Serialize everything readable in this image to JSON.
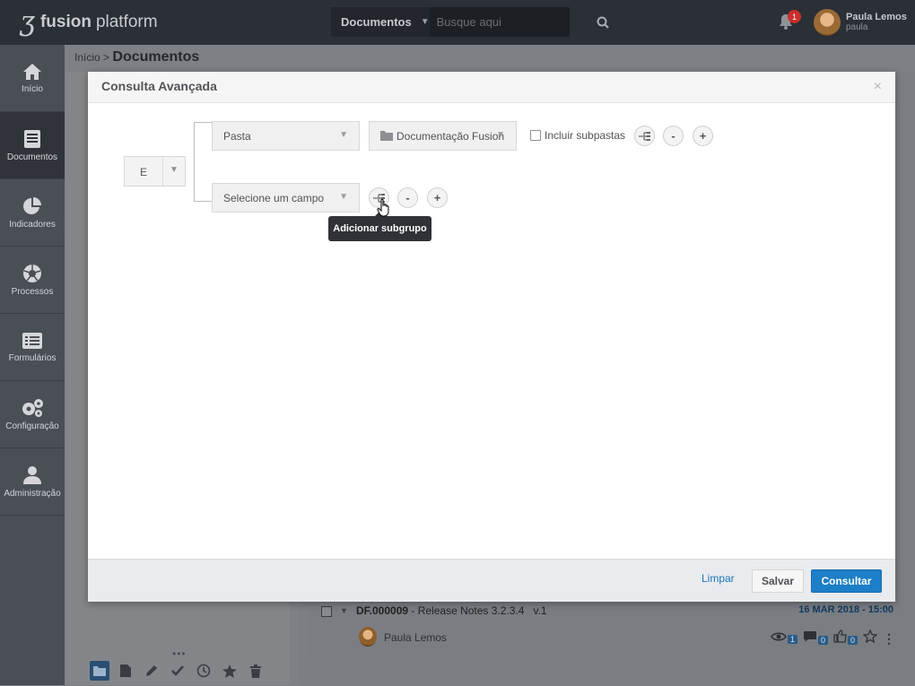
{
  "header": {
    "brand_bold": "fusion",
    "brand_light": "platform",
    "search_scope": "Documentos",
    "search_placeholder": "Busque aqui",
    "notifications_count": "1",
    "user_name": "Paula Lemos",
    "user_login": "paula"
  },
  "sidebar": {
    "items": [
      {
        "label": "Início",
        "icon": "home-icon"
      },
      {
        "label": "Documentos",
        "icon": "documents-icon",
        "active": true
      },
      {
        "label": "Indicadores",
        "icon": "pie-chart-icon"
      },
      {
        "label": "Processos",
        "icon": "aperture-icon"
      },
      {
        "label": "Formulários",
        "icon": "form-list-icon"
      },
      {
        "label": "Configuração",
        "icon": "gears-icon"
      },
      {
        "label": "Administração",
        "icon": "user-icon"
      }
    ]
  },
  "breadcrumb": {
    "root": "Início",
    "separator": ">",
    "current": "Documentos"
  },
  "modal": {
    "title": "Consulta Avançada",
    "close": "×",
    "operator": "E",
    "row1": {
      "field": "Pasta",
      "folder": "Documentação Fusion",
      "include_subfolders_label": "Incluir subpastas",
      "include_subfolders_checked": false
    },
    "row2": {
      "field_placeholder": "Selecione um campo"
    },
    "minus": "-",
    "plus": "+",
    "tooltip": "Adicionar subgrupo",
    "footer": {
      "clear": "Limpar",
      "save": "Salvar",
      "submit": "Consultar"
    }
  },
  "document_row": {
    "code": "DF.000009",
    "title": " - Release Notes 3.2.3.4",
    "version": "v.1",
    "date": "16 MAR 2018 - 15:00",
    "author": "Paula Lemos",
    "views": "1",
    "comments": "0",
    "likes": "0"
  },
  "colors": {
    "topbar": "#2b2f36",
    "sidebar": "#4a4e55",
    "primary": "#1c7fc7",
    "link": "#1d74bb",
    "badge": "#c9302c"
  }
}
